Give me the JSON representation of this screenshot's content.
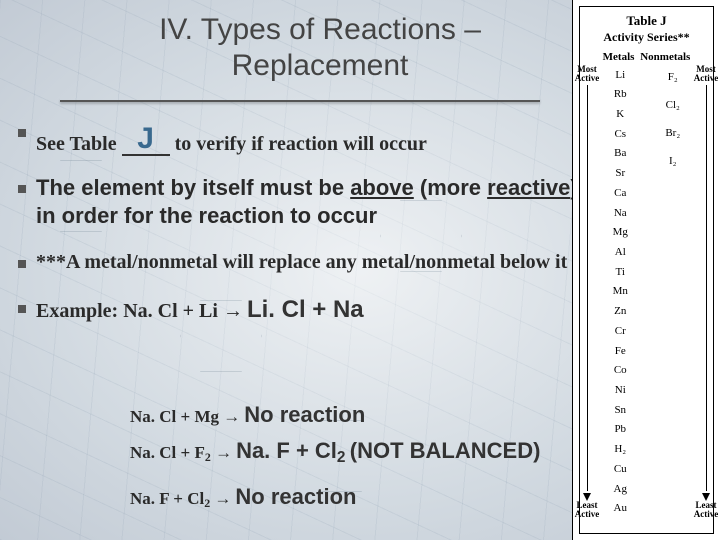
{
  "title_line1": "IV. Types of Reactions –",
  "title_line2": "Replacement",
  "bullet1_a": "See Table ",
  "bullet1_J": "J",
  "bullet1_b": " to verify if reaction will occur",
  "bullet2_a": "The element by itself must be ",
  "bullet2_above": "above",
  "bullet2_b": " (more ",
  "bullet2_reactive": "reactive",
  "bullet2_c": ") in order for the reaction to occur",
  "bullet3": "***A metal/nonmetal will replace any metal/nonmetal below it",
  "bullet4_label": "Example: Na. Cl + Li ",
  "bullet4_arrow": "→",
  "bullet4_rhs": "Li. Cl + Na",
  "sub1_lhs": "Na. Cl + Mg ",
  "sub1_rhs": "No reaction",
  "sub2_lhs": "Na. Cl + F",
  "sub2_note": "(NOT BALANCED)",
  "sub2_rhs_a": "Na. F + Cl",
  "sub3_lhs": "Na. F + Cl",
  "sub3_rhs": "No reaction",
  "arrow_sym": "→",
  "table": {
    "title": "Table J",
    "subtitle": "Activity Series**",
    "head_metals": "Metals",
    "head_nonmetals": "Nonmetals",
    "tag_most": "Most\nActive",
    "tag_least": "Least\nActive",
    "metals": [
      "Li",
      "Rb",
      "K",
      "Cs",
      "Ba",
      "Sr",
      "Ca",
      "Na",
      "Mg",
      "Al",
      "Ti",
      "Mn",
      "Zn",
      "Cr",
      "Fe",
      "Co",
      "Ni",
      "Sn",
      "Pb",
      "H₂",
      "Cu",
      "Ag",
      "Au"
    ],
    "nonmetals": [
      "F₂",
      "Cl₂",
      "Br₂",
      "I₂"
    ]
  }
}
